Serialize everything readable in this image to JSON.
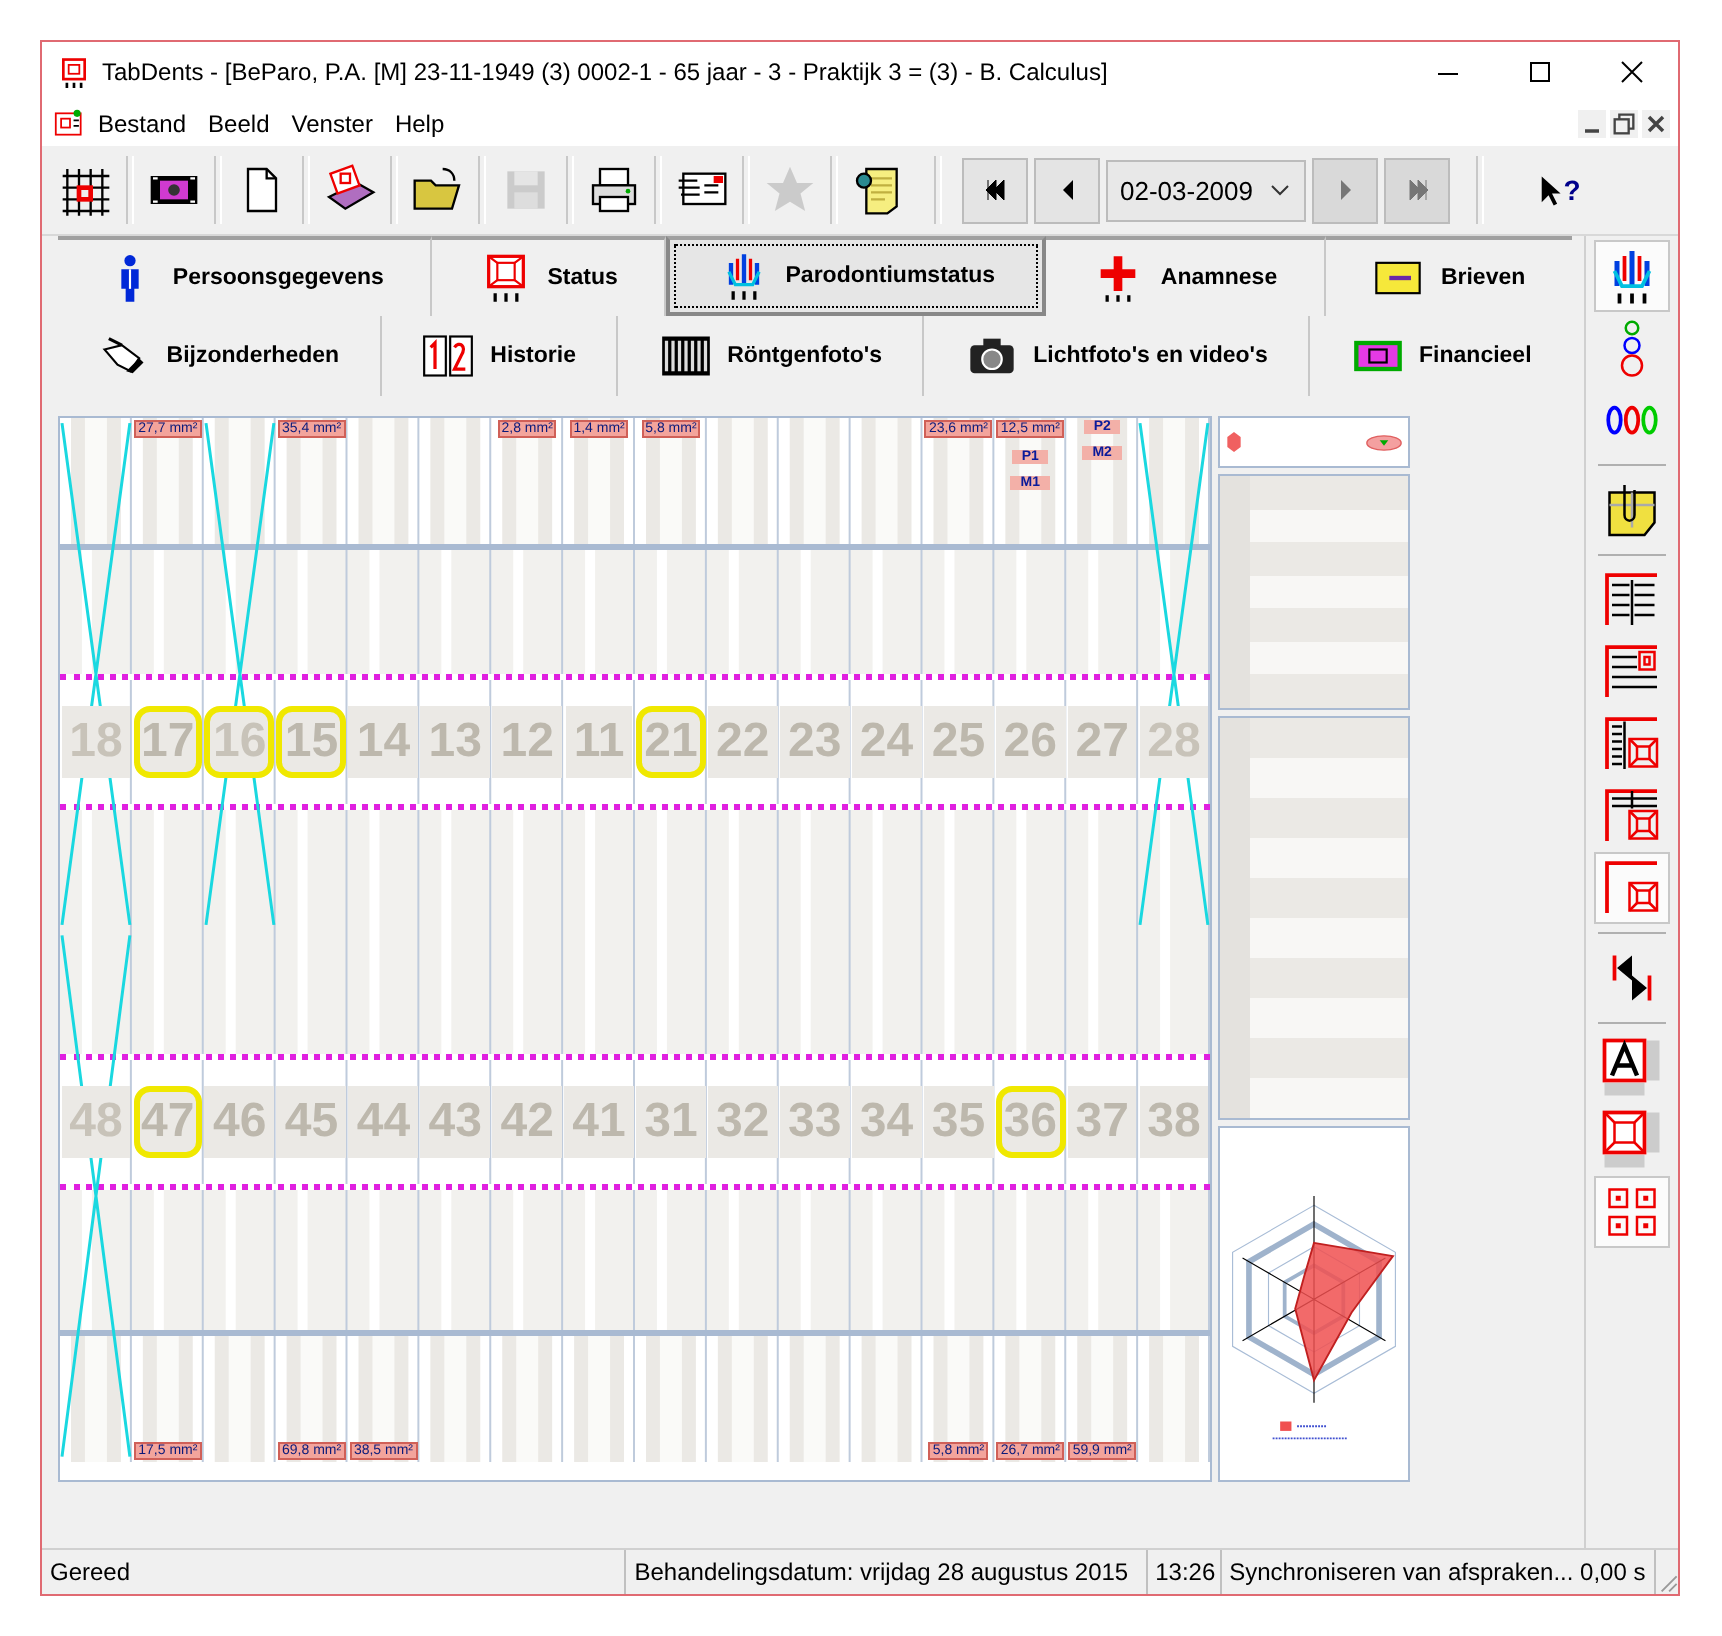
{
  "window": {
    "title": "TabDents - [BeParo, P.A. [M] 23-11-1949 (3) 0002-1 - 65 jaar - 3 - Praktijk 3 = (3) - B. Calculus]"
  },
  "menu": [
    "Bestand",
    "Beeld",
    "Venster",
    "Help"
  ],
  "toolbar": {
    "buttons": [
      {
        "kind": "grid",
        "disabled": false
      },
      {
        "kind": "film",
        "disabled": false
      },
      {
        "kind": "page",
        "disabled": false
      },
      {
        "kind": "cards",
        "disabled": false
      },
      {
        "kind": "folder",
        "disabled": false
      },
      {
        "kind": "save",
        "disabled": true
      },
      {
        "kind": "print",
        "disabled": false
      },
      {
        "kind": "letter",
        "disabled": false
      },
      {
        "kind": "star",
        "disabled": true
      },
      {
        "kind": "pin-note",
        "disabled": false
      }
    ],
    "nav_back": [
      {
        "kind": "first",
        "disabled": false
      },
      {
        "kind": "prev",
        "disabled": false
      }
    ],
    "date": "02-03-2009",
    "nav_forward": [
      {
        "kind": "next",
        "disabled": true
      },
      {
        "kind": "last",
        "disabled": true
      }
    ],
    "help": "?"
  },
  "tabs": [
    [
      {
        "label": "Persoonsgegevens",
        "kind": "person",
        "selected": false
      },
      {
        "label": "Status",
        "kind": "status",
        "selected": false
      },
      {
        "label": "Parodontiumstatus",
        "kind": "perio",
        "selected": true
      },
      {
        "label": "Anamnese",
        "kind": "cross",
        "selected": false
      },
      {
        "label": "Brieven",
        "kind": "envelope",
        "selected": false
      }
    ],
    [
      {
        "label": "Bijzonderheden",
        "kind": "hand",
        "selected": false
      },
      {
        "label": "Historie",
        "kind": "history",
        "selected": false
      },
      {
        "label": "Röntgenfoto's",
        "kind": "xray",
        "selected": false
      },
      {
        "label": "Lichtfoto's en video's",
        "kind": "camera",
        "selected": false
      },
      {
        "label": "Financieel",
        "kind": "money",
        "selected": false
      }
    ]
  ],
  "chart": {
    "upper": [
      {
        "number": "18",
        "missing": true,
        "crown": false
      },
      {
        "number": "17",
        "area": "27,7 mm²",
        "missing": false,
        "crown": true
      },
      {
        "number": "16",
        "missing": true,
        "crown": true
      },
      {
        "number": "15",
        "area": "35,4 mm²",
        "missing": false,
        "crown": true
      },
      {
        "number": "14",
        "missing": false,
        "crown": false
      },
      {
        "number": "13",
        "missing": false,
        "crown": false
      },
      {
        "number": "12",
        "area": "2,8 mm²",
        "missing": false,
        "crown": false
      },
      {
        "number": "11",
        "area": "1,4 mm²",
        "missing": false,
        "crown": false
      },
      {
        "number": "21",
        "area": "5,8 mm²",
        "missing": false,
        "crown": true
      },
      {
        "number": "22",
        "missing": false,
        "crown": false
      },
      {
        "number": "23",
        "missing": false,
        "crown": false
      },
      {
        "number": "24",
        "missing": false,
        "crown": false
      },
      {
        "number": "25",
        "area": "23,6 mm²",
        "missing": false,
        "crown": false
      },
      {
        "number": "26",
        "area": "12,5 mm²",
        "labels": [
          "P1",
          "M1"
        ],
        "missing": false,
        "crown": false
      },
      {
        "number": "27",
        "labels": [
          "P2",
          "M2"
        ],
        "missing": false,
        "crown": false
      },
      {
        "number": "28",
        "missing": true,
        "crown": false
      }
    ],
    "lower": [
      {
        "number": "48",
        "missing": true,
        "crown": false
      },
      {
        "number": "47",
        "area": "17,5 mm²",
        "missing": false,
        "crown": true
      },
      {
        "number": "46",
        "missing": false,
        "crown": false
      },
      {
        "number": "45",
        "area": "69,8 mm²",
        "missing": false,
        "crown": false
      },
      {
        "number": "44",
        "area": "38,5 mm²",
        "missing": false,
        "crown": false
      },
      {
        "number": "43",
        "missing": false,
        "crown": false
      },
      {
        "number": "42",
        "missing": false,
        "crown": false
      },
      {
        "number": "41",
        "missing": false,
        "crown": false
      },
      {
        "number": "31",
        "missing": false,
        "crown": false
      },
      {
        "number": "32",
        "missing": false,
        "crown": false
      },
      {
        "number": "33",
        "missing": false,
        "crown": false
      },
      {
        "number": "34",
        "missing": false,
        "crown": false
      },
      {
        "number": "35",
        "area": "5,8 mm²",
        "missing": false,
        "crown": false
      },
      {
        "number": "36",
        "area": "26,7 mm²",
        "missing": false,
        "crown": true
      },
      {
        "number": "37",
        "area": "59,9 mm²",
        "missing": false,
        "crown": false
      },
      {
        "number": "38",
        "missing": false,
        "crown": false
      }
    ]
  },
  "side_tools": [
    [
      {
        "kind": "perio",
        "selected": true
      },
      {
        "kind": "probe",
        "selected": false
      },
      {
        "kind": "depth",
        "selected": false
      }
    ],
    [
      {
        "kind": "note",
        "selected": false
      }
    ],
    [
      {
        "kind": "doc-lines",
        "selected": false
      },
      {
        "kind": "doc-tooth",
        "selected": false
      },
      {
        "kind": "doc-split",
        "selected": false
      },
      {
        "kind": "doc-grid",
        "selected": false
      },
      {
        "kind": "doc-corner",
        "selected": true
      }
    ],
    [
      {
        "kind": "navigate",
        "selected": false
      }
    ],
    [
      {
        "kind": "font",
        "selected": false
      },
      {
        "kind": "tooth-size",
        "selected": false
      },
      {
        "kind": "grid4",
        "selected": true
      }
    ]
  ],
  "status_bar": [
    "Gereed",
    "Behandelingsdatum: vrijdag 28 augustus 2015",
    "13:26",
    "Synchroniseren van afspraken... 0,00 s"
  ]
}
